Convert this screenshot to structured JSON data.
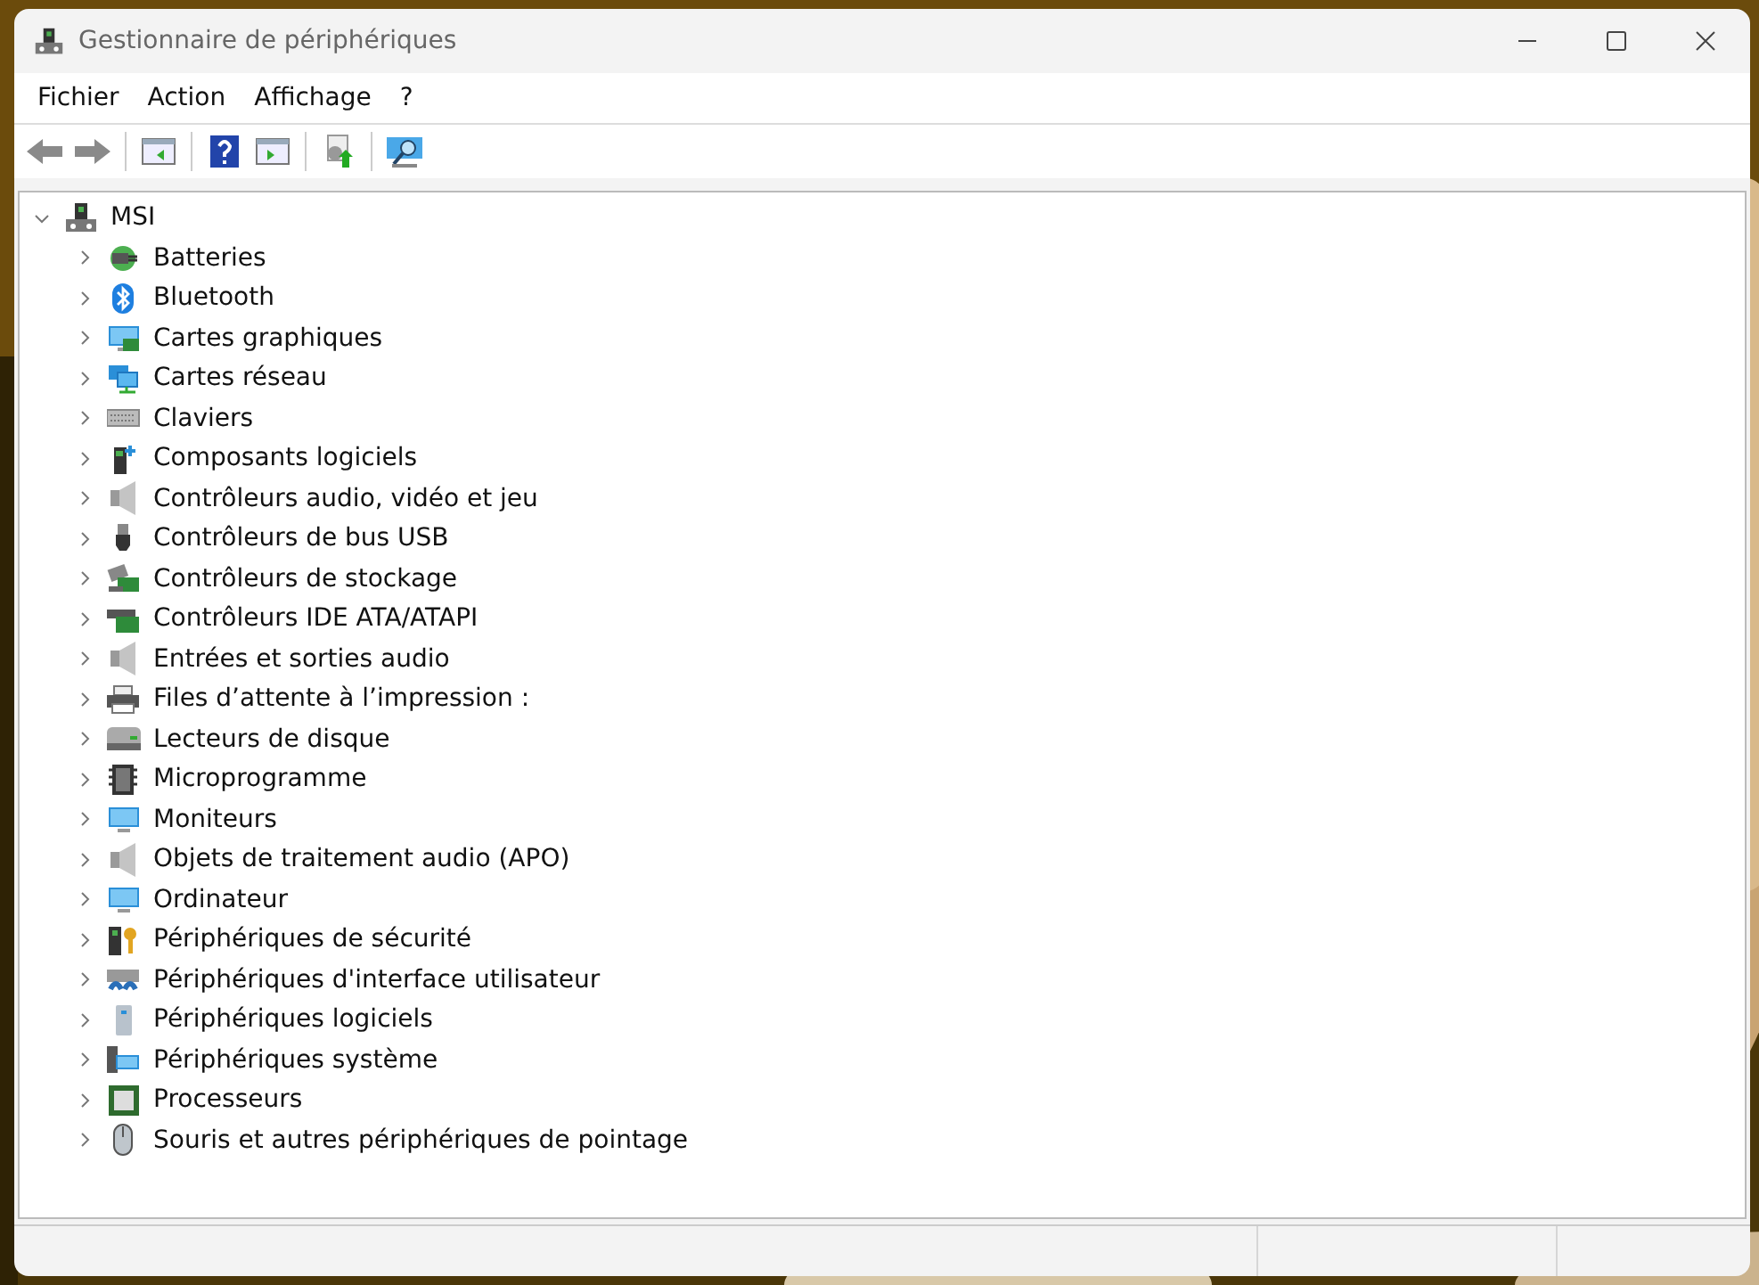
{
  "window": {
    "title": "Gestionnaire de périphériques"
  },
  "menu": [
    "Fichier",
    "Action",
    "Affichage",
    "?"
  ],
  "tree": {
    "label": "MSI",
    "expanded": true,
    "children": [
      {
        "label": "Batteries",
        "expanded": false
      },
      {
        "label": "Bluetooth",
        "expanded": false
      },
      {
        "label": "Cartes graphiques",
        "expanded": false
      },
      {
        "label": "Cartes réseau",
        "expanded": false
      },
      {
        "label": "Claviers",
        "expanded": false
      },
      {
        "label": "Composants logiciels",
        "expanded": false
      },
      {
        "label": "Contrôleurs audio, vidéo et jeu",
        "expanded": false
      },
      {
        "label": "Contrôleurs de bus USB",
        "expanded": false
      },
      {
        "label": "Contrôleurs de stockage",
        "expanded": false
      },
      {
        "label": "Contrôleurs IDE ATA/ATAPI",
        "expanded": false
      },
      {
        "label": "Entrées et sorties audio",
        "expanded": false
      },
      {
        "label": "Files d’attente à l’impression :",
        "expanded": false
      },
      {
        "label": "Lecteurs de disque",
        "expanded": false
      },
      {
        "label": "Microprogramme",
        "expanded": false
      },
      {
        "label": "Moniteurs",
        "expanded": false
      },
      {
        "label": "Objets de traitement audio (APO)",
        "expanded": false
      },
      {
        "label": "Ordinateur",
        "expanded": false
      },
      {
        "label": "Périphériques de sécurité",
        "expanded": false
      },
      {
        "label": "Périphériques d'interface utilisateur",
        "expanded": false
      },
      {
        "label": "Périphériques logiciels",
        "expanded": false
      },
      {
        "label": "Périphériques système",
        "expanded": false
      },
      {
        "label": "Processeurs",
        "expanded": false
      },
      {
        "label": "Souris et autres périphériques de pointage",
        "expanded": false
      }
    ]
  }
}
